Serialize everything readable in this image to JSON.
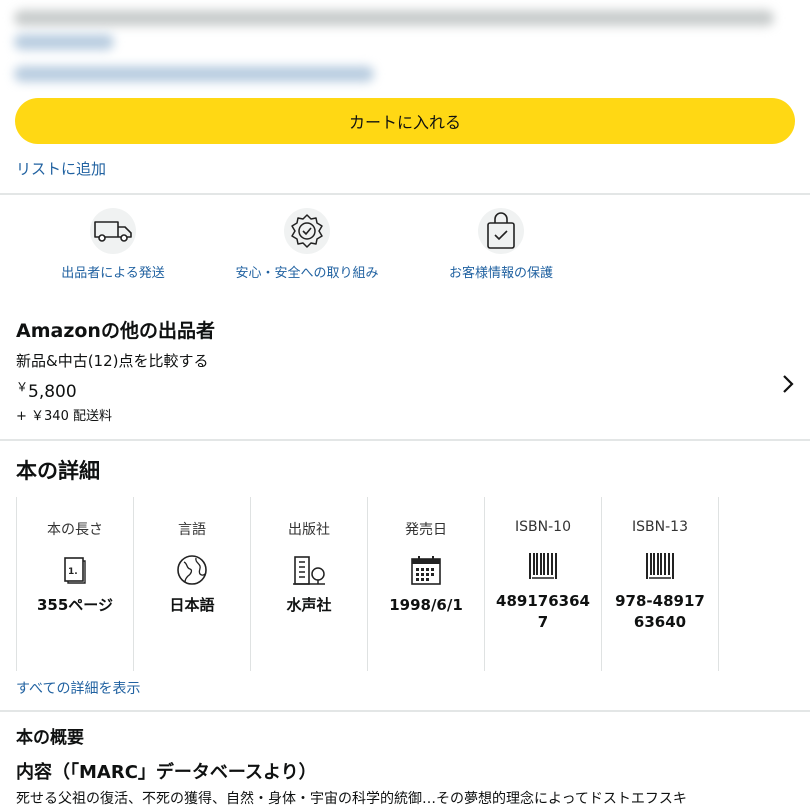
{
  "colors": {
    "button_yellow": "#ffd814",
    "link_blue": "#2162a1",
    "divider": "#e3e6e6"
  },
  "cart_button": {
    "label": "カートに入れる"
  },
  "add_to_list": {
    "label": "リストに追加"
  },
  "features": [
    {
      "icon": "truck-icon",
      "label": "出品者による発送"
    },
    {
      "icon": "shield-badge-icon",
      "label": "安心・安全への取り組み"
    },
    {
      "icon": "lock-bag-icon",
      "label": "お客様情報の保護"
    }
  ],
  "other_sellers": {
    "title": "Amazonの他の出品者",
    "compare": "新品&中古(12)点を比較する",
    "price_symbol": "￥",
    "price_value": "5,800",
    "shipping": "+ ￥340 配送料"
  },
  "book_details": {
    "title": "本の詳細",
    "cards": [
      {
        "heading": "本の長さ",
        "icon": "page-icon",
        "value": "355ページ"
      },
      {
        "heading": "言語",
        "icon": "globe-icon",
        "value": "日本語"
      },
      {
        "heading": "出版社",
        "icon": "building-icon",
        "value": "水声社"
      },
      {
        "heading": "発売日",
        "icon": "calendar-icon",
        "value": "1998/6/1"
      },
      {
        "heading": "ISBN-10",
        "icon": "barcode-icon",
        "value": "4891763647"
      },
      {
        "heading": "ISBN-13",
        "icon": "barcode-icon",
        "value": "978-4891763640"
      }
    ],
    "show_all": "すべての詳細を表示"
  },
  "summary": {
    "title": "本の概要",
    "content_heading": "内容（「MARC」データベースより）",
    "content_text": "死せる父祖の復活、不死の獲得、自然・身体・宇宙の科学的統御…その夢想的理念によってドストエフスキ"
  }
}
